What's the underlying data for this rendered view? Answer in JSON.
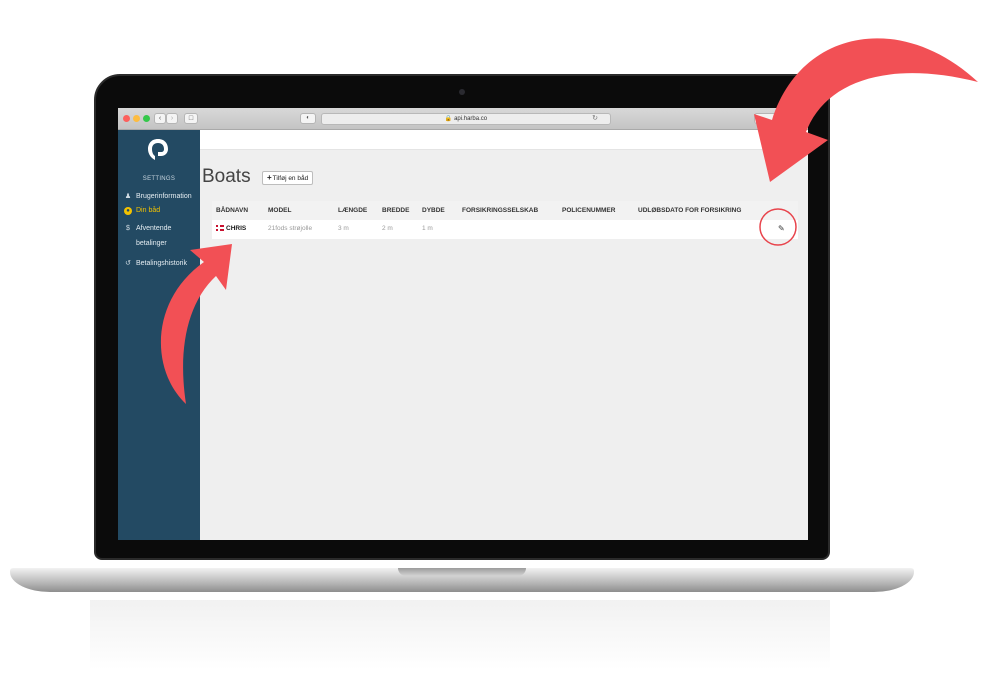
{
  "browser": {
    "url": "api.harba.co",
    "lock_icon": "lock-icon",
    "reload_icon": "reload-icon"
  },
  "sidebar": {
    "section_label": "SETTINGS",
    "items": [
      {
        "label": "Brugerinformation",
        "icon": "user-icon",
        "active": false
      },
      {
        "label": "Din båd",
        "icon": "boat-icon",
        "active": true
      },
      {
        "label": "Afventende",
        "icon": "dollar-icon",
        "active": false
      },
      {
        "label": "betalinger",
        "icon": "",
        "active": false
      },
      {
        "label": "Betalingshistorik",
        "icon": "history-icon",
        "active": false
      }
    ]
  },
  "main": {
    "title": "Boats",
    "add_button_label": "Tilføj en båd",
    "table": {
      "headers": [
        "BÅDNAVN",
        "MODEL",
        "LÆNGDE",
        "BREDDE",
        "DYBDE",
        "FORSIKRINGSSELSKAB",
        "POLICENUMMER",
        "UDLØBSDATO FOR FORSIKRING"
      ],
      "rows": [
        {
          "name": "CHRIS",
          "model": "21fods strøjolle",
          "length": "3 m",
          "width": "2 m",
          "depth": "1 m",
          "insurer": "",
          "policy": "",
          "expiry": ""
        }
      ]
    }
  },
  "colors": {
    "sidebar_bg": "#234a63",
    "accent_yellow": "#f3c200",
    "arrow_red": "#f25055"
  }
}
